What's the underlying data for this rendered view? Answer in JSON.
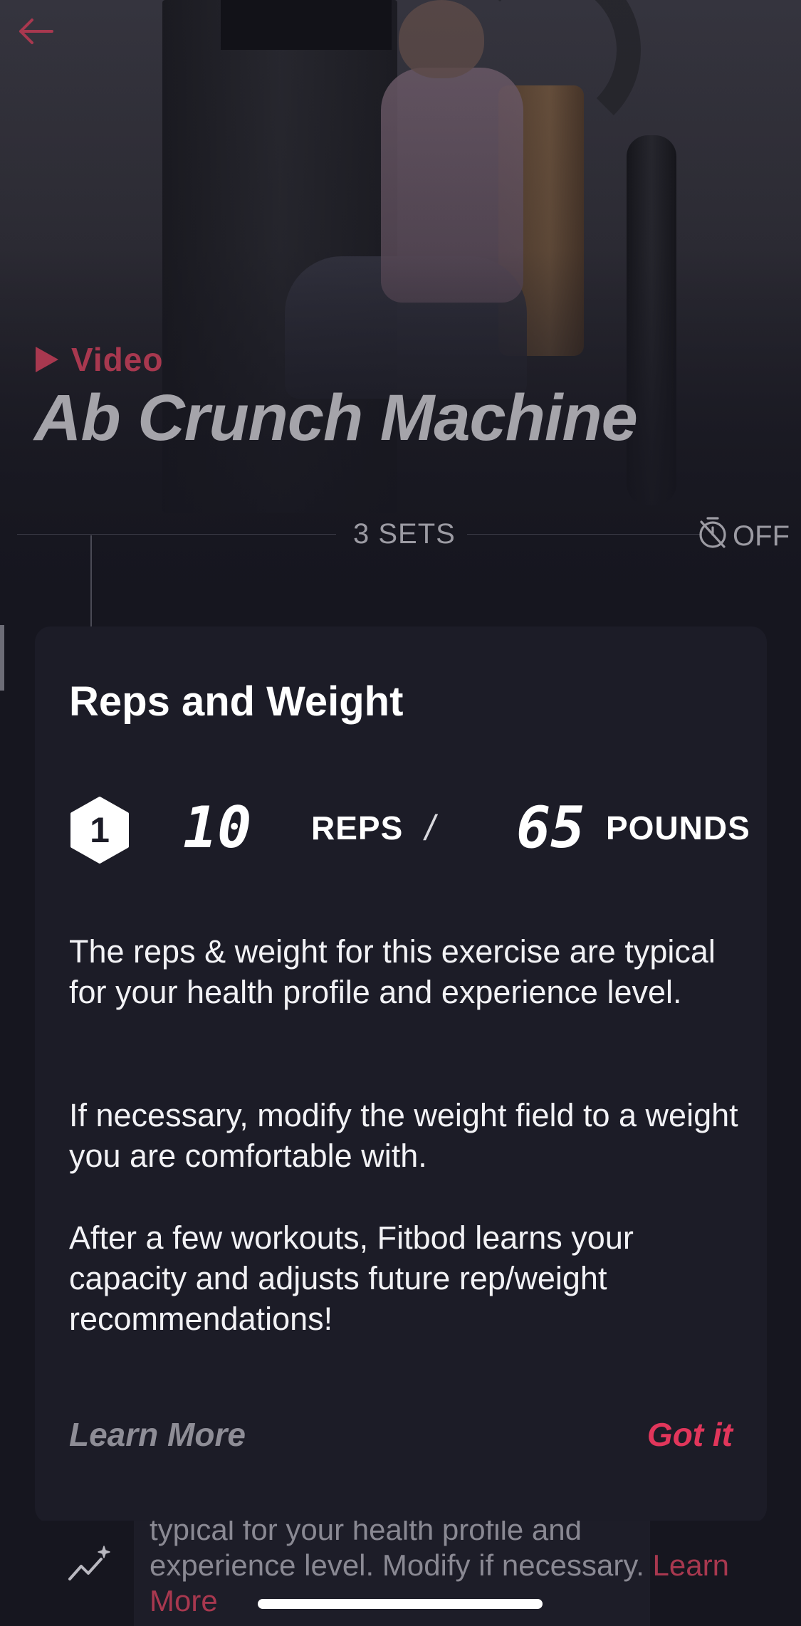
{
  "header": {
    "back_icon": "arrow-left-icon",
    "video_label": "Video",
    "exercise_title": "Ab Crunch Machine"
  },
  "sets_bar": {
    "sets_label": "3 SETS",
    "timer_icon": "timer-off-icon",
    "timer_label": "OFF"
  },
  "modal": {
    "title": "Reps and Weight",
    "set_number": "1",
    "reps_value": "10",
    "reps_unit": "REPS",
    "separator": "/",
    "weight_value": "65",
    "weight_unit": "POUNDS",
    "paragraph_1": "The reps & weight for this exercise are typical for your health profile and experience level.",
    "paragraph_2": "If necessary, modify the weight field to a weight you are comfortable with.",
    "paragraph_3": "After a few workouts, Fitbod learns your capacity and adjusts future rep/weight recommendations!",
    "learn_more_label": "Learn More",
    "got_it_label": "Got it"
  },
  "tip": {
    "icon": "trend-sparkle-icon",
    "line_1": "typical for your health profile and",
    "line_2": "experience level. Modify if necessary.",
    "link_1": "Learn",
    "link_2": "More"
  },
  "colors": {
    "accent": "#e1365b",
    "accent_dim": "#a8384f",
    "card_bg": "#1c1c27",
    "page_bg": "#16161f"
  }
}
